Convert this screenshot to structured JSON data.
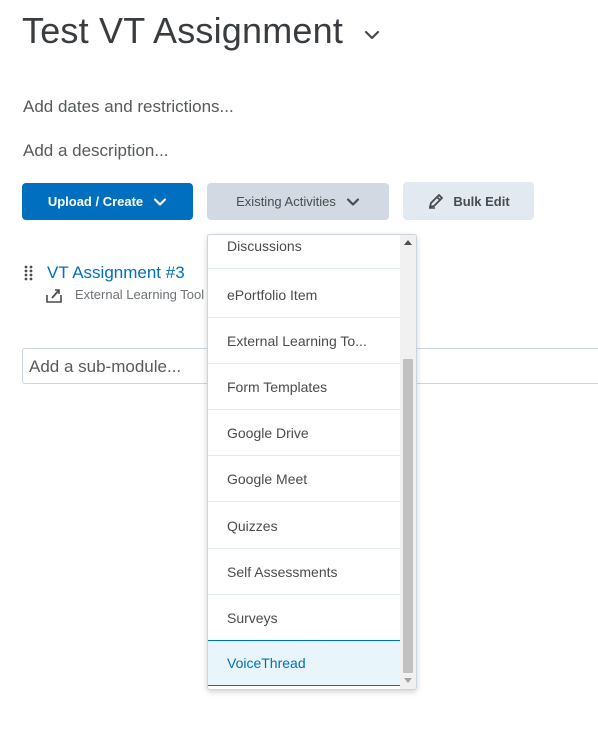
{
  "page": {
    "title": "Test VT Assignment",
    "add_dates": "Add dates and restrictions...",
    "add_description": "Add a description..."
  },
  "toolbar": {
    "upload_create": "Upload / Create",
    "existing_activities": "Existing Activities",
    "bulk_edit": "Bulk Edit"
  },
  "content_item": {
    "title": "VT Assignment #3",
    "type": "External Learning Tool"
  },
  "submodule": {
    "placeholder": "Add a sub-module..."
  },
  "dropdown": {
    "items": [
      "Discussions",
      "ePortfolio Item",
      "External Learning To...",
      "Form Templates",
      "Google Drive",
      "Google Meet",
      "Quizzes",
      "Self Assessments",
      "Surveys",
      "VoiceThread"
    ],
    "selected": "VoiceThread"
  },
  "colors": {
    "primary": "#006fbf",
    "selected_bg": "#e8f6fb"
  }
}
